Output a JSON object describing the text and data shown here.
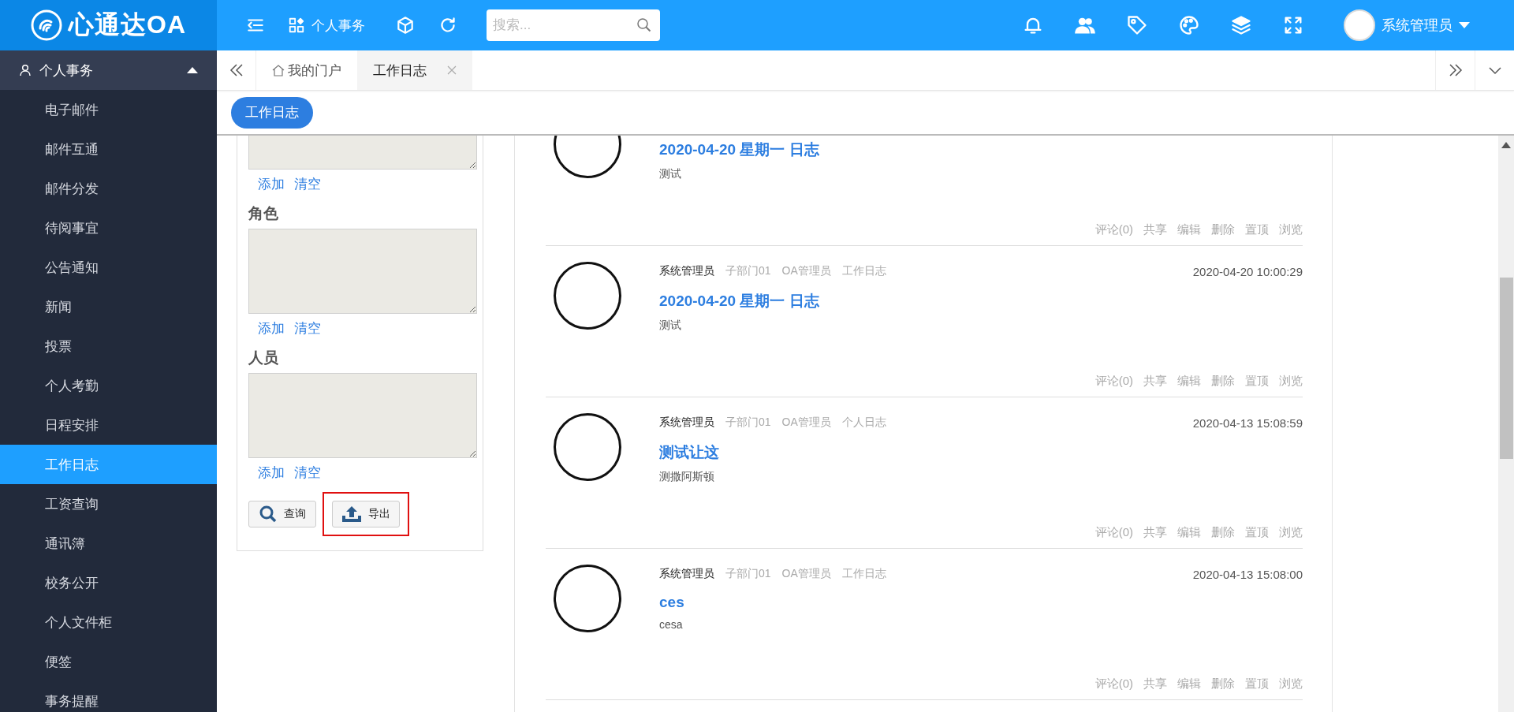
{
  "header": {
    "logo": "心通达OA",
    "module": "个人事务",
    "search": {
      "placeholder": "搜索..."
    },
    "user": "系统管理员"
  },
  "sidebar": {
    "group": {
      "label": "个人事务",
      "expanded": true
    },
    "items": [
      {
        "label": "电子邮件",
        "selected": false
      },
      {
        "label": "邮件互通",
        "selected": false
      },
      {
        "label": "邮件分发",
        "selected": false
      },
      {
        "label": "待阅事宜",
        "selected": false
      },
      {
        "label": "公告通知",
        "selected": false
      },
      {
        "label": "新闻",
        "selected": false
      },
      {
        "label": "投票",
        "selected": false
      },
      {
        "label": "个人考勤",
        "selected": false
      },
      {
        "label": "日程安排",
        "selected": false
      },
      {
        "label": "工作日志",
        "selected": true
      },
      {
        "label": "工资查询",
        "selected": false
      },
      {
        "label": "通讯簿",
        "selected": false
      },
      {
        "label": "校务公开",
        "selected": false
      },
      {
        "label": "个人文件柜",
        "selected": false
      },
      {
        "label": "便签",
        "selected": false
      },
      {
        "label": "事务提醒",
        "selected": false
      }
    ]
  },
  "tabs": [
    {
      "label": "我的门户",
      "kind": "home",
      "selected": false
    },
    {
      "label": "工作日志",
      "kind": "closable",
      "selected": true
    }
  ],
  "page_button": "工作日志",
  "filter": {
    "groups": [
      {
        "links": [
          "添加",
          "清空"
        ]
      },
      {
        "label": "角色",
        "links": [
          "添加",
          "清空"
        ]
      },
      {
        "label": "人员",
        "links": [
          "添加",
          "清空"
        ]
      }
    ],
    "buttons": [
      {
        "label": "查询",
        "kind": "search",
        "highlighted": false
      },
      {
        "label": "导出",
        "kind": "export",
        "highlighted": true
      }
    ]
  },
  "entries": [
    {
      "title": "2020-04-20 星期一 日志",
      "body": "测试",
      "actions": [
        "评论(0)",
        "共享",
        "编辑",
        "删除",
        "置顶",
        "浏览"
      ]
    },
    {
      "author": "系统管理员",
      "dept": "子部门01",
      "role": "OA管理员",
      "type": "工作日志",
      "time": "2020-04-20 10:00:29",
      "title": "2020-04-20 星期一 日志",
      "body": "测试",
      "actions": [
        "评论(0)",
        "共享",
        "编辑",
        "删除",
        "置顶",
        "浏览"
      ]
    },
    {
      "author": "系统管理员",
      "dept": "子部门01",
      "role": "OA管理员",
      "type": "个人日志",
      "time": "2020-04-13 15:08:59",
      "title": "测试让这",
      "body": "测撒阿斯顿",
      "actions": [
        "评论(0)",
        "共享",
        "编辑",
        "删除",
        "置顶",
        "浏览"
      ]
    },
    {
      "author": "系统管理员",
      "dept": "子部门01",
      "role": "OA管理员",
      "type": "工作日志",
      "time": "2020-04-13 15:08:00",
      "title": "ces",
      "body": "cesa",
      "actions": [
        "评论(0)",
        "共享",
        "编辑",
        "删除",
        "置顶",
        "浏览"
      ]
    }
  ]
}
